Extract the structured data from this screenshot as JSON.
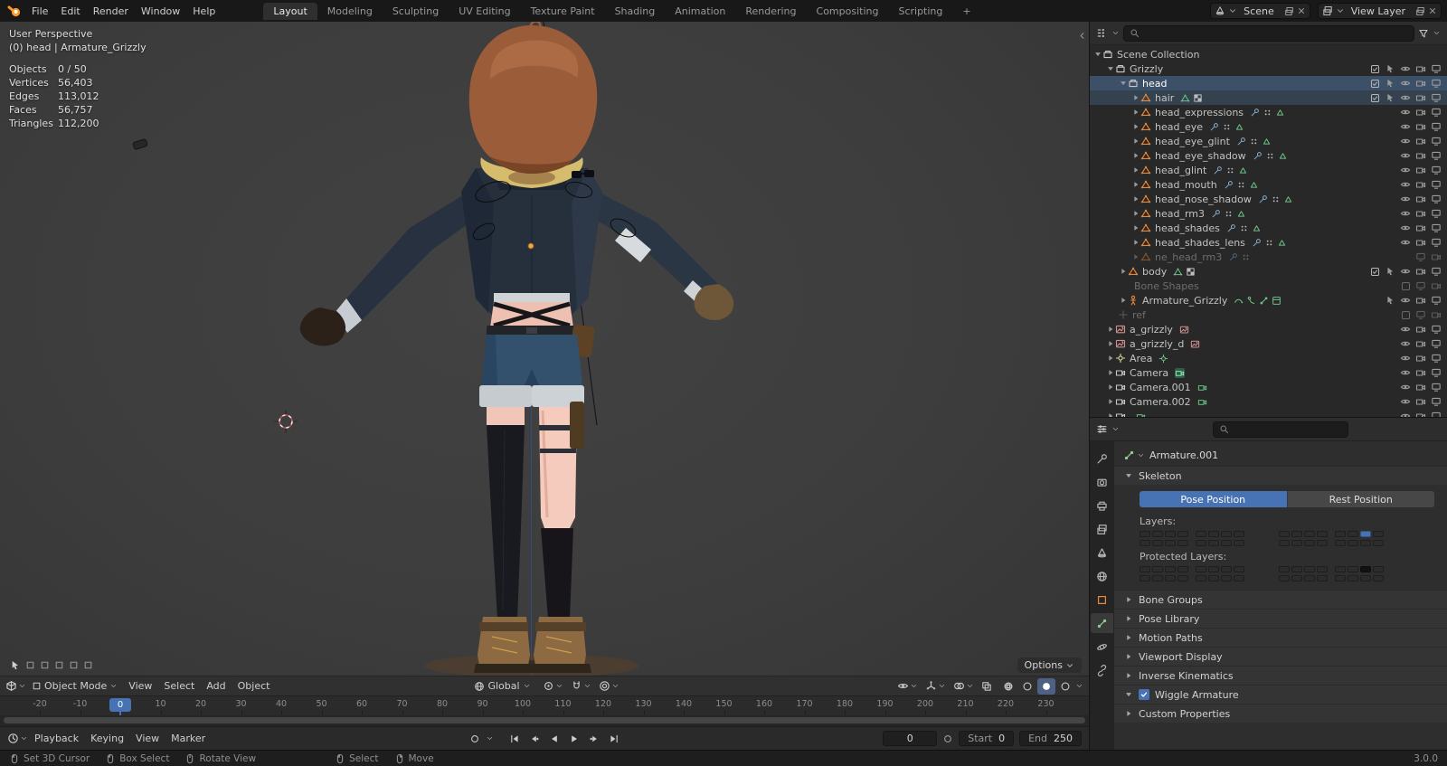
{
  "colors": {
    "accent": "#4772b3",
    "orange": "#e8883a",
    "green": "#6fbf86",
    "header_bg": "#303030",
    "viewport_bg": "#3d3d3d"
  },
  "topbar": {
    "menus": [
      "File",
      "Edit",
      "Render",
      "Window",
      "Help"
    ],
    "tabs": [
      "Layout",
      "Modeling",
      "Sculpting",
      "UV Editing",
      "Texture Paint",
      "Shading",
      "Animation",
      "Rendering",
      "Compositing",
      "Scripting",
      "+"
    ],
    "active_tab": "Layout",
    "scene_selector": {
      "label": "Scene"
    },
    "view_layer_selector": {
      "label": "View Layer"
    }
  },
  "viewport": {
    "overlay": {
      "line1": "User Perspective",
      "line2": "(0) head | Armature_Grizzly",
      "stats": [
        {
          "label": "Objects",
          "value": "0 / 50"
        },
        {
          "label": "Vertices",
          "value": "56,403"
        },
        {
          "label": "Edges",
          "value": "113,012"
        },
        {
          "label": "Faces",
          "value": "56,757"
        },
        {
          "label": "Triangles",
          "value": "112,200"
        }
      ]
    },
    "tool_settings": {
      "options_label": "Options"
    },
    "header": {
      "mode": "Object Mode",
      "menus": [
        "View",
        "Select",
        "Add",
        "Object"
      ],
      "orientation": "Global"
    }
  },
  "outliner": {
    "rows": [
      {
        "label": "Scene Collection",
        "indent": 0,
        "disc": "down",
        "icon": "collection",
        "mid": [],
        "right": []
      },
      {
        "label": "Grizzly",
        "indent": 1,
        "disc": "down",
        "icon": "collection",
        "checkbox": "on",
        "mid": [],
        "right": [
          "cursor",
          "eye",
          "camera",
          "screen"
        ]
      },
      {
        "label": "head",
        "indent": 2,
        "disc": "down",
        "icon": "collection",
        "checkbox": "on",
        "sel": "active",
        "mid": [],
        "right": [
          "cursor",
          "eye",
          "camera",
          "screen"
        ]
      },
      {
        "label": "hair",
        "indent": 3,
        "disc": "right",
        "icon": "mesh",
        "checkbox": "on",
        "sel": "selected",
        "mid": [
          "mesh-data",
          "texture"
        ],
        "right": [
          "cursor",
          "eye",
          "camera",
          "screen"
        ]
      },
      {
        "label": "head_expressions",
        "indent": 3,
        "disc": "right",
        "icon": "mesh",
        "mid": [
          "wrench",
          "grid",
          "tri"
        ],
        "right": [
          "eye",
          "camera",
          "screen"
        ]
      },
      {
        "label": "head_eye",
        "indent": 3,
        "disc": "right",
        "icon": "mesh",
        "mid": [
          "wrench",
          "grid",
          "tri"
        ],
        "right": [
          "eye",
          "camera",
          "screen"
        ]
      },
      {
        "label": "head_eye_glint",
        "indent": 3,
        "disc": "right",
        "icon": "mesh",
        "mid": [
          "wrench",
          "grid",
          "tri"
        ],
        "right": [
          "eye",
          "camera",
          "screen"
        ]
      },
      {
        "label": "head_eye_shadow",
        "indent": 3,
        "disc": "right",
        "icon": "mesh",
        "mid": [
          "wrench",
          "grid",
          "tri"
        ],
        "right": [
          "eye",
          "camera",
          "screen"
        ]
      },
      {
        "label": "head_glint",
        "indent": 3,
        "disc": "right",
        "icon": "mesh",
        "mid": [
          "wrench",
          "grid",
          "tri"
        ],
        "right": [
          "eye",
          "camera",
          "screen"
        ]
      },
      {
        "label": "head_mouth",
        "indent": 3,
        "disc": "right",
        "icon": "mesh",
        "mid": [
          "wrench",
          "grid",
          "tri"
        ],
        "right": [
          "eye",
          "camera",
          "screen"
        ]
      },
      {
        "label": "head_nose_shadow",
        "indent": 3,
        "disc": "right",
        "icon": "mesh",
        "mid": [
          "wrench",
          "grid",
          "tri"
        ],
        "right": [
          "eye",
          "camera",
          "screen"
        ]
      },
      {
        "label": "head_rm3",
        "indent": 3,
        "disc": "right",
        "icon": "mesh",
        "mid": [
          "wrench",
          "grid",
          "tri"
        ],
        "right": [
          "eye",
          "camera",
          "screen"
        ]
      },
      {
        "label": "head_shades",
        "indent": 3,
        "disc": "right",
        "icon": "mesh",
        "mid": [
          "wrench",
          "grid",
          "tri"
        ],
        "right": [
          "eye",
          "camera",
          "screen"
        ]
      },
      {
        "label": "head_shades_lens",
        "indent": 3,
        "disc": "right",
        "icon": "mesh",
        "mid": [
          "wrench",
          "grid",
          "tri"
        ],
        "right": [
          "eye",
          "camera",
          "screen"
        ]
      },
      {
        "label": "ne_head_rm3",
        "indent": 3,
        "disc": "right",
        "icon": "mesh",
        "dim": true,
        "mid": [
          "wrench",
          "grid"
        ],
        "right": [
          "screen",
          "camera"
        ]
      },
      {
        "label": "body",
        "indent": 2,
        "disc": "right",
        "icon": "mesh",
        "checkbox": "on",
        "mid": [
          "mesh-data",
          "texture"
        ],
        "right": [
          "cursor",
          "eye",
          "camera",
          "screen"
        ]
      },
      {
        "label": "Bone Shapes",
        "indent": 2,
        "disc": "none",
        "icon": "none",
        "dim": true,
        "checkbox": "off",
        "mid": [],
        "right": [
          "screen",
          "camera"
        ]
      },
      {
        "label": "Armature_Grizzly",
        "indent": 2,
        "disc": "right",
        "icon": "armature",
        "mid": [
          "motion",
          "pose",
          "bone",
          "action"
        ],
        "right": [
          "cursor",
          "eye",
          "camera",
          "screen"
        ]
      },
      {
        "label": "ref",
        "indent": 1,
        "disc": "none",
        "icon": "empty",
        "dim": true,
        "checkbox": "off",
        "mid": [],
        "right": [
          "screen",
          "camera"
        ]
      },
      {
        "label": "a_grizzly",
        "indent": 1,
        "disc": "right",
        "icon": "image",
        "mid": [
          "image-data"
        ],
        "right": [
          "eye",
          "camera",
          "screen"
        ]
      },
      {
        "label": "a_grizzly_d",
        "indent": 1,
        "disc": "right",
        "icon": "image",
        "mid": [
          "image-data"
        ],
        "right": [
          "eye",
          "camera",
          "screen"
        ]
      },
      {
        "label": "Area",
        "indent": 1,
        "disc": "right",
        "icon": "light",
        "mid": [
          "light-data"
        ],
        "right": [
          "eye",
          "camera",
          "screen"
        ]
      },
      {
        "label": "Camera",
        "indent": 1,
        "disc": "right",
        "icon": "camera",
        "mid": [
          "camera-data-on"
        ],
        "right": [
          "eye",
          "camera",
          "screen"
        ]
      },
      {
        "label": "Camera.001",
        "indent": 1,
        "disc": "right",
        "icon": "camera",
        "mid": [
          "camera-data"
        ],
        "right": [
          "eye",
          "camera",
          "screen"
        ]
      },
      {
        "label": "Camera.002",
        "indent": 1,
        "disc": "right",
        "icon": "camera",
        "mid": [
          "camera-data"
        ],
        "right": [
          "eye",
          "camera",
          "screen"
        ]
      },
      {
        "label": "",
        "indent": 1,
        "disc": "right",
        "icon": "camera",
        "mid": [
          "camera-data"
        ],
        "right": [
          "eye",
          "camera",
          "screen"
        ]
      }
    ]
  },
  "properties": {
    "tabs": [
      {
        "name": "tool"
      },
      {
        "name": "render"
      },
      {
        "name": "output"
      },
      {
        "name": "view-layer"
      },
      {
        "name": "scene"
      },
      {
        "name": "world"
      },
      {
        "name": "object"
      },
      {
        "name": "data-bone",
        "active": true
      },
      {
        "name": "physics"
      },
      {
        "name": "constraints"
      }
    ],
    "breadcrumb": "Armature.001",
    "skeleton": {
      "title": "Skeleton",
      "pose_label": "Pose Position",
      "rest_label": "Rest Position",
      "layers_label": "Layers:",
      "protected_label": "Protected Layers:",
      "layers": [
        [
          [
            0,
            0,
            0,
            0,
            0,
            0,
            0,
            0
          ],
          [
            0,
            0,
            0,
            0,
            0,
            0,
            0,
            0
          ]
        ],
        [
          [
            0,
            0,
            0,
            0,
            0,
            0,
            1,
            0
          ],
          [
            0,
            0,
            0,
            0,
            0,
            0,
            0,
            0
          ]
        ]
      ],
      "protected_layers": [
        [
          [
            0,
            0,
            0,
            0,
            0,
            0,
            0,
            0
          ],
          [
            0,
            0,
            0,
            0,
            0,
            0,
            0,
            0
          ]
        ],
        [
          [
            0,
            0,
            0,
            0,
            0,
            0,
            1,
            0
          ],
          [
            0,
            0,
            0,
            0,
            0,
            0,
            0,
            0
          ]
        ]
      ]
    },
    "sections": [
      {
        "label": "Bone Groups"
      },
      {
        "label": "Pose Library"
      },
      {
        "label": "Motion Paths"
      },
      {
        "label": "Viewport Display"
      },
      {
        "label": "Inverse Kinematics"
      },
      {
        "label": "Wiggle Armature",
        "expanded": true,
        "checked": true
      },
      {
        "label": "Custom Properties"
      }
    ]
  },
  "timeline": {
    "ticks": [
      -20,
      -10,
      0,
      10,
      20,
      30,
      40,
      50,
      60,
      70,
      80,
      90,
      100,
      110,
      120,
      130,
      140,
      150,
      160,
      170,
      180,
      190,
      200,
      210,
      220,
      230
    ],
    "current_frame": 0
  },
  "playback": {
    "menus": [
      "Playback",
      "Keying",
      "View",
      "Marker"
    ],
    "current_frame": "0",
    "start_label": "Start",
    "start_value": "0",
    "end_label": "End",
    "end_value": "250"
  },
  "statusbar": {
    "hints": [
      {
        "icon": "mouse-left",
        "label": "Set 3D Cursor"
      },
      {
        "icon": "mouse-left",
        "label": "Box Select"
      },
      {
        "icon": "mouse-middle",
        "label": "Rotate View"
      },
      {
        "icon": "mouse-left",
        "label": "Select",
        "grp2": true
      },
      {
        "icon": "mouse-right",
        "label": "Move"
      }
    ],
    "version": "3.0.0"
  }
}
